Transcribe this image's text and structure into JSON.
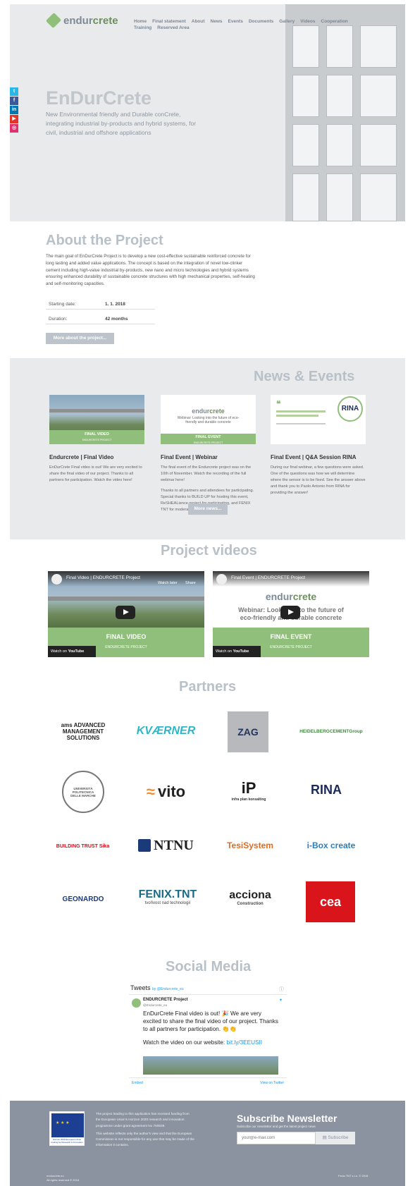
{
  "brand": {
    "name_a": "endur",
    "name_b": "crete"
  },
  "nav": [
    "Home",
    "Final statement",
    "About",
    "News",
    "Events",
    "Documents",
    "Gallery",
    "Videos",
    "Cooperation",
    "Training",
    "Reserved Area"
  ],
  "social": [
    {
      "icon": "twitter-icon",
      "glyph": "t",
      "color": "#29b6e8"
    },
    {
      "icon": "facebook-icon",
      "glyph": "f",
      "color": "#3b5998"
    },
    {
      "icon": "linkedin-icon",
      "glyph": "in",
      "color": "#0077b5"
    },
    {
      "icon": "youtube-icon",
      "glyph": "▶",
      "color": "#e5332a"
    },
    {
      "icon": "instagram-icon",
      "glyph": "◎",
      "color": "#e1306c"
    }
  ],
  "hero": {
    "title": "EnDurCrete",
    "subtitle": "New Environmental friendly and Durable conCrete, integrating industrial by-products and hybrid systems, for civil, industrial and offshore applications"
  },
  "about": {
    "title": "About the Project",
    "text": "The main goal of EnDurCrete Project is to develop a new cost-effective sustainable reinforced concrete for long lasting and added value applications. The concept is based on the integration of novel low-clinker cement including high-value industrial by-products, new nano and micro technologies and hybrid systems ensuring enhanced durability of sustainable concrete structures with high mechanical properties, self-healing and self-monitoring capacities.",
    "start_label": "Starting date:",
    "start_value": "1. 1. 2018",
    "duration_label": "Duration:",
    "duration_value": "42 months",
    "more_button": "More about the project..."
  },
  "news": {
    "title": "News & Events",
    "more_button": "More news...",
    "cards": [
      {
        "title": "Endurcrete | Final Video",
        "band": "FINAL VIDEO",
        "band_sub": "ENDURCRETE PROJECT",
        "text": "EnDurCrete Final video is out! We are very excited to share the final video of our project. Thanks to all partners for participation. Watch the video here!",
        "text2": ""
      },
      {
        "title": "Final Event | Webinar",
        "band": "FINAL EVENT",
        "band_sub": "ENDURCRETE PROJECT",
        "headline": "Webinar: Looking into the future of eco-friendly and durable concrete",
        "text": "The final event of the Endurcrete project was on the 10th of November. Watch the recording of the full webinar here!",
        "text2": "Thanks to all partners and attendees for participating. Special thanks to BUILD UP for hosting this event, ReSHEALience project for participating, and FENIX TNT for moderating!"
      },
      {
        "title": "Final Event | Q&A Session RINA",
        "logo": "RINA",
        "text": "During our final webinar, a few questions were asked. One of the questions was how we will determine where the sensor is to be fixed. See the answer above and thank you to Paolo Antonio from RINA for providing the answer!",
        "text2": ""
      }
    ]
  },
  "videos": {
    "title": "Project videos",
    "items": [
      {
        "title": "Final Video | ENDURCRETE Project",
        "band": "FINAL VIDEO",
        "band_sub": "ENDURCRETE PROJECT",
        "watch_later": "Watch later",
        "share": "Share",
        "watch_on": "Watch on",
        "yt": "YouTube"
      },
      {
        "title": "Final Event | ENDURCRETE Project",
        "band": "FINAL EVENT",
        "band_sub": "ENDURCRETE PROJECT",
        "headline": "Webinar: Looking into the future of eco-friendly and durable concrete",
        "watch_later": "",
        "share": "",
        "watch_on": "Watch on",
        "yt": "YouTube"
      }
    ]
  },
  "partners": {
    "title": "Partners",
    "logos": [
      "ams ADVANCED MANAGEMENT SOLUTIONS",
      "KVÆRNER",
      "ZAG",
      "HEIDELBERGCEMENTGroup",
      "UNIVERSITÀ POLITECNICA DELLE MARCHE",
      "vito",
      "infra plan konsalting",
      "RINA",
      "BUILDING TRUST Sika",
      "NTNU",
      "TesiSystem",
      "i-Box create",
      "GEONARDO",
      "FENIX.TNT",
      "tvořivost nad technologií",
      "acciona",
      "Construction",
      "cea"
    ]
  },
  "social_media": {
    "title": "Social Media",
    "tweets_label": "Tweets",
    "by_label": "by @Endurcrete_eu",
    "account": "ENDURCRETE Project",
    "handle": "@Endurcrete_eu",
    "tweet": "EnDurCrete Final video is out! 🎉 We are very excited to share the final video of our project. Thanks to all partners for participation. 👏👏",
    "tweet2": "Watch the video on our website:",
    "link": "bit.ly/3EEUSII",
    "embed": "Embed",
    "view": "View on Twitter"
  },
  "footer": {
    "eu_caption": "Horizon 2020 European Union funding for Research & Innovation",
    "text1": "The project leading to this application has received funding from the European Union's Horizon 2020 research and innovation programme under grant agreement No 760639.",
    "text2": "This website reflects only the author's view and that the European Commission is not responsible for any use that may be made of the information it contains.",
    "newsletter_title": "Subscribe Newsletter",
    "newsletter_sub": "Subscribe our newsletter and get the latest project news",
    "email_placeholder": "your@e-mail.com",
    "subscribe": "Subscribe",
    "site": "endurcrete.eu",
    "rights": "All rights reserved © 2018",
    "credit": "Fenix TNT s.r.o. © 2018"
  }
}
